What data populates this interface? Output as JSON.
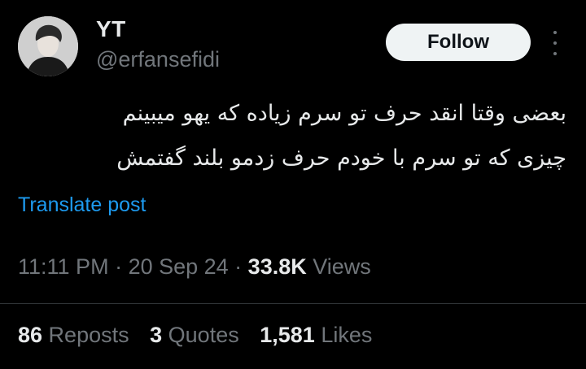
{
  "author": {
    "display_name": "YT",
    "handle": "@erfansefidi"
  },
  "follow_label": "Follow",
  "tweet": {
    "lines": [
      "بعضی وقتا انقد حرف تو سرم زیاده که یهو میبینم",
      "چیزی که تو سرم با خودم حرف زدمو بلند گفتمش"
    ]
  },
  "translate_label": "Translate post",
  "meta": {
    "time": "11:11 PM",
    "sep1": " · ",
    "date": "20 Sep 24",
    "sep2": " · ",
    "views_count": "33.8K",
    "views_label": " Views"
  },
  "stats": {
    "reposts_count": "86",
    "reposts_label": " Reposts",
    "quotes_count": "3",
    "quotes_label": " Quotes",
    "likes_count": "1,581",
    "likes_label": " Likes"
  },
  "icons": {
    "more": "more-options-icon"
  }
}
